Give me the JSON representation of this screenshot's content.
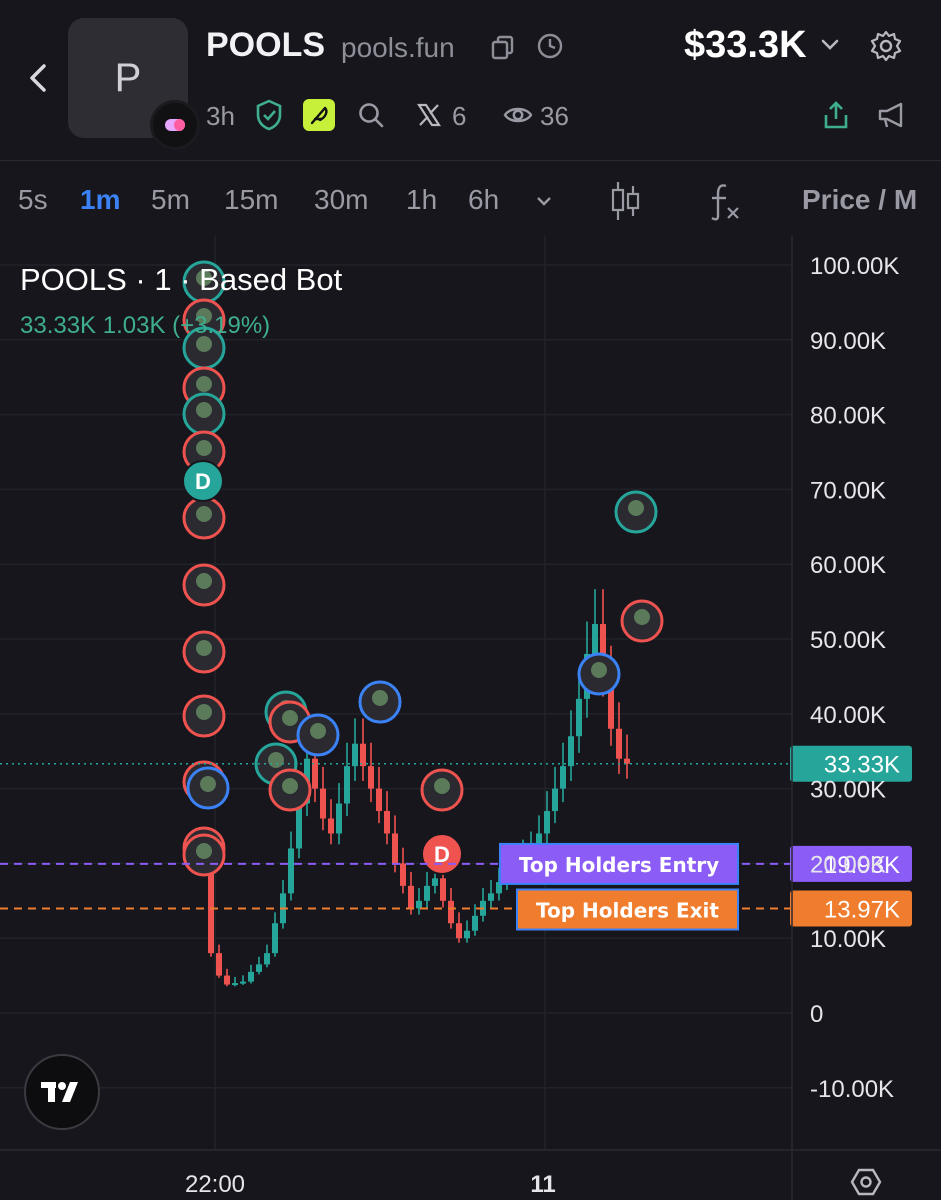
{
  "header": {
    "avatar_letter": "P",
    "title": "POOLS",
    "domain": "pools.fun",
    "age": "3h",
    "x_count": "6",
    "views": "36",
    "market_cap": "$33.3K"
  },
  "timeframes": [
    {
      "label": "5s",
      "active": false
    },
    {
      "label": "1m",
      "active": true
    },
    {
      "label": "5m",
      "active": false
    },
    {
      "label": "15m",
      "active": false
    },
    {
      "label": "30m",
      "active": false
    },
    {
      "label": "1h",
      "active": false
    },
    {
      "label": "6h",
      "active": false
    }
  ],
  "price_toggle": "Price / M",
  "chart": {
    "legend_title": "POOLS · 1 · Based Bot",
    "legend_values": "33.33K  1.03K (+3.19%)",
    "y_ticks": [
      "100.00K",
      "90.00K",
      "80.00K",
      "70.00K",
      "60.00K",
      "50.00K",
      "40.00K",
      "30.00K",
      "20.00K",
      "10.00K",
      "0",
      "-10.00K"
    ],
    "x_ticks": [
      "22:00",
      "11"
    ],
    "last_price": "33.33K",
    "entry_price": "19.93K",
    "exit_price": "13.97K",
    "entry_label": "Top Holders Entry",
    "exit_label": "Top Holders Exit",
    "dev_marker": "D",
    "colors": {
      "up": "#26a69a",
      "down": "#ef5350",
      "entry": "#8b5cf6",
      "exit": "#f07c2e",
      "accent": "#3b82f6"
    }
  },
  "chart_data": {
    "type": "candlestick",
    "title": "POOLS · 1 · Based Bot",
    "ylim": [
      -10000,
      100000
    ],
    "last": 33330,
    "lines": [
      {
        "name": "Top Holders Entry",
        "value": 19930
      },
      {
        "name": "Top Holders Exit",
        "value": 13970
      }
    ],
    "close_series": [
      20000,
      8000,
      5000,
      3800,
      4000,
      4200,
      5500,
      6500,
      8000,
      12000,
      16000,
      22000,
      28000,
      34000,
      30000,
      26000,
      24000,
      28000,
      33000,
      36000,
      33000,
      30000,
      27000,
      24000,
      20000,
      17000,
      14000,
      15000,
      17000,
      18000,
      15000,
      12000,
      10000,
      11000,
      13000,
      15000,
      16000,
      17500,
      18500,
      20000,
      21000,
      22000,
      24000,
      27000,
      30000,
      33000,
      37000,
      42000,
      48000,
      52000,
      45000,
      38000,
      34000,
      33330
    ]
  }
}
